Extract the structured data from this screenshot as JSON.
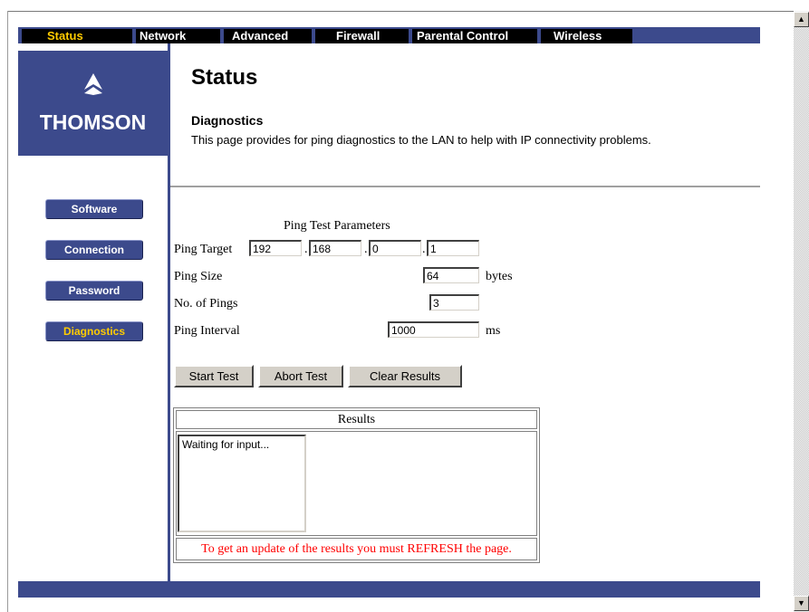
{
  "top_nav": {
    "tabs": [
      {
        "label": "Status",
        "active": true
      },
      {
        "label": "Network",
        "active": false
      },
      {
        "label": "Advanced",
        "active": false
      },
      {
        "label": "Firewall",
        "active": false
      },
      {
        "label": "Parental Control",
        "active": false
      },
      {
        "label": "Wireless",
        "active": false
      }
    ]
  },
  "brand": {
    "name": "THOMSON",
    "logo_icon": "thomson-logo-icon"
  },
  "sidebar": {
    "items": [
      {
        "label": "Software",
        "active": false
      },
      {
        "label": "Connection",
        "active": false
      },
      {
        "label": "Password",
        "active": false
      },
      {
        "label": "Diagnostics",
        "active": true
      }
    ]
  },
  "page": {
    "title": "Status",
    "section_title": "Diagnostics",
    "section_description": "This page provides for ping diagnostics to the LAN to help with IP connectivity problems."
  },
  "ping": {
    "header": "Ping Test Parameters",
    "target_label": "Ping Target",
    "target_octets": [
      "192",
      "168",
      "0",
      "1"
    ],
    "size_label": "Ping Size",
    "size_value": "64",
    "size_unit": "bytes",
    "count_label": "No. of Pings",
    "count_value": "3",
    "interval_label": "Ping Interval",
    "interval_value": "1000",
    "interval_unit": "ms"
  },
  "buttons": {
    "start": "Start Test",
    "abort": "Abort Test",
    "clear": "Clear Results"
  },
  "results": {
    "header": "Results",
    "text": "Waiting for input...",
    "note": "To get an update of the results you must REFRESH the page."
  },
  "colors": {
    "nav_blue": "#3c4a8c",
    "active_yellow": "#ffcc00",
    "note_red": "#ff0000"
  }
}
